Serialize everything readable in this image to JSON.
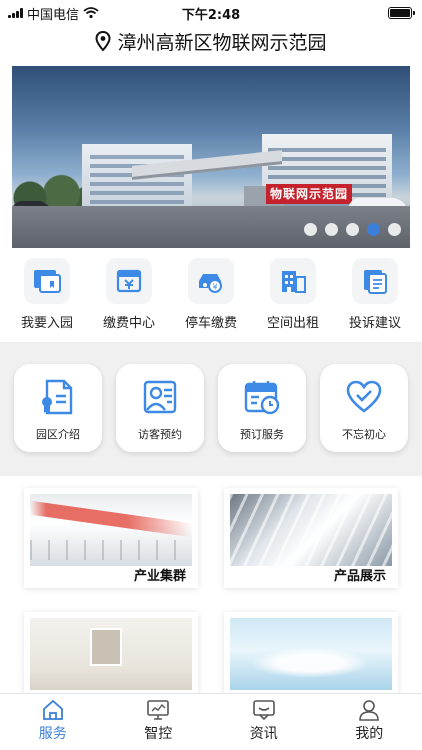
{
  "status": {
    "carrier": "中国电信",
    "time": "下午2:48"
  },
  "header": {
    "title": "漳州高新区物联网示范园"
  },
  "banner": {
    "sign_text": "物联网示范园",
    "slide_count": 5,
    "active_slide": 4
  },
  "quick_actions": [
    {
      "label": "我要入园",
      "icon": "enter-park-icon"
    },
    {
      "label": "缴费中心",
      "icon": "payment-center-icon"
    },
    {
      "label": "停车缴费",
      "icon": "parking-fee-icon"
    },
    {
      "label": "空间出租",
      "icon": "space-rental-icon"
    },
    {
      "label": "投诉建议",
      "icon": "complaint-icon"
    }
  ],
  "features": [
    {
      "label": "园区介绍",
      "icon": "park-intro-icon"
    },
    {
      "label": "访客预约",
      "icon": "visitor-icon"
    },
    {
      "label": "预订服务",
      "icon": "calendar-icon"
    },
    {
      "label": "不忘初心",
      "icon": "heart-icon"
    }
  ],
  "categories": [
    {
      "label": "产业集群"
    },
    {
      "label": "产品展示"
    },
    {
      "label": ""
    },
    {
      "label": ""
    }
  ],
  "tabs": [
    {
      "label": "服务",
      "icon": "home-icon"
    },
    {
      "label": "智控",
      "icon": "monitor-icon"
    },
    {
      "label": "资讯",
      "icon": "message-icon"
    },
    {
      "label": "我的",
      "icon": "user-icon"
    }
  ],
  "colors": {
    "accent": "#3b7fd8",
    "icon_blue": "#3d8ae6",
    "section_bg": "#f0f0f0"
  }
}
